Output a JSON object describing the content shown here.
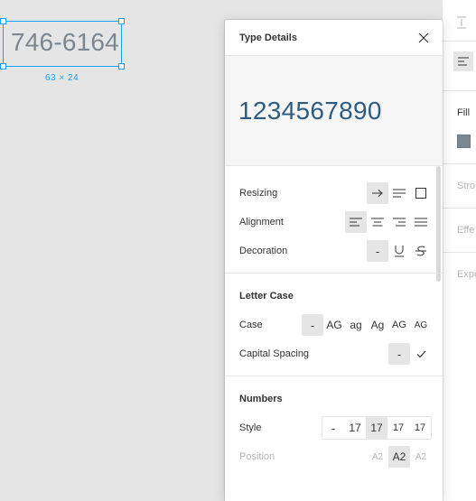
{
  "canvas": {
    "layer_text": "746-6164",
    "size_label": "63 × 24"
  },
  "sidebar": {
    "fill_label": "Fill",
    "stroke_label": "Stro",
    "effects_label": "Effe",
    "export_label": "Expo",
    "fill_color": "#7c8791"
  },
  "panel": {
    "title": "Type Details",
    "preview_text": "1234567890",
    "basics": {
      "resizing_label": "Resizing",
      "alignment_label": "Alignment",
      "decoration_label": "Decoration",
      "decoration_none": "-"
    },
    "letter_case": {
      "title": "Letter Case",
      "case_label": "Case",
      "case_options": [
        "-",
        "AG",
        "ag",
        "Ag",
        "AG",
        "AG"
      ],
      "capital_spacing_label": "Capital Spacing",
      "capital_spacing_none": "-"
    },
    "numbers": {
      "title": "Numbers",
      "style_label": "Style",
      "style_options": [
        "-",
        "17",
        "17",
        "17",
        "17"
      ],
      "position_label": "Position",
      "position_options": [
        "A2",
        "A2",
        "A2"
      ]
    },
    "colors": {
      "accent": "#18a0fb",
      "preview_text": "#2c5c84",
      "selected_bg": "#e5e5e5"
    }
  }
}
